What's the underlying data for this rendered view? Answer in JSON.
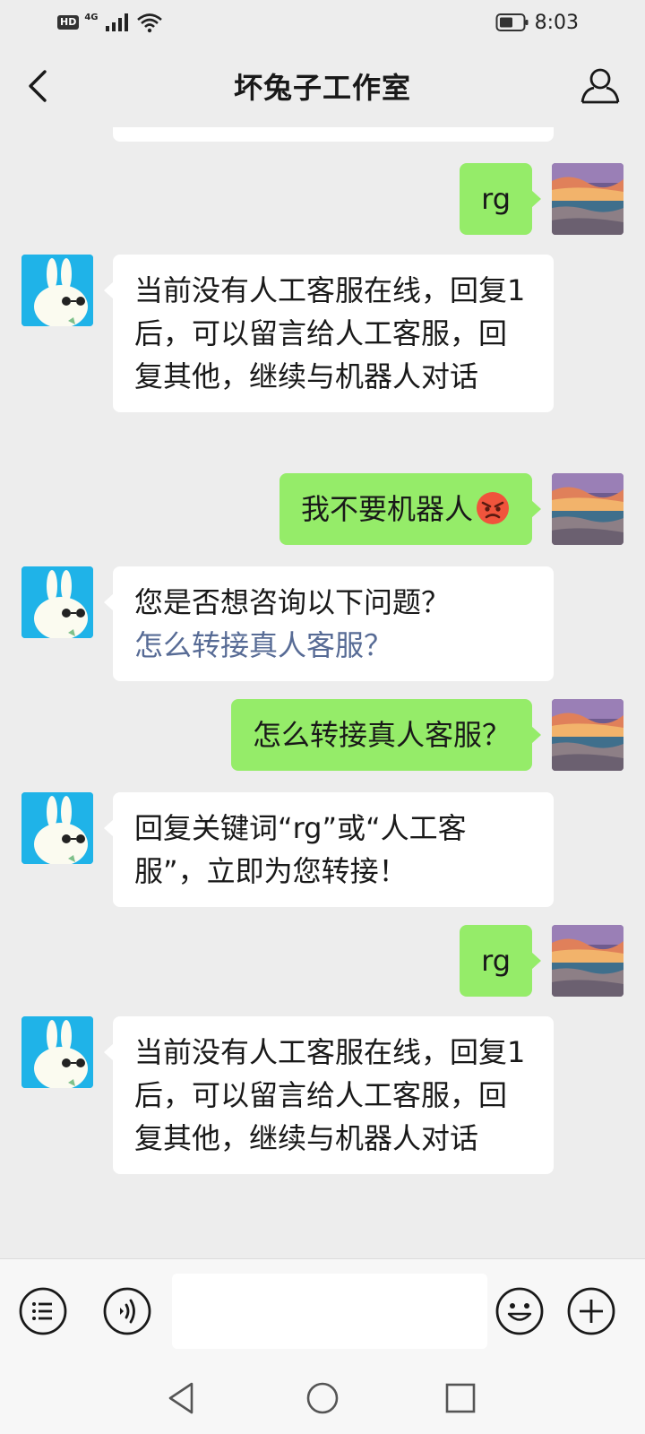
{
  "status_bar": {
    "hd": "HD",
    "network": "4G",
    "time": "8:03",
    "icons": [
      "signal-icon",
      "wifi-icon",
      "battery-icon"
    ]
  },
  "nav": {
    "title": "坏兔子工作室",
    "back_icon": "chevron-left-icon",
    "profile_icon": "person-icon"
  },
  "messages": [
    {
      "side": "out",
      "text": "rg"
    },
    {
      "side": "in",
      "text": "当前没有人工客服在线，回复1后，可以留言给人工客服，回复其他，继续与机器人对话"
    },
    {
      "side": "out",
      "text": "我不要机器人",
      "emoji": "angry-face-emoji"
    },
    {
      "side": "in",
      "text": "您是否想咨询以下问题？",
      "link": "怎么转接真人客服？"
    },
    {
      "side": "out",
      "text": "怎么转接真人客服？"
    },
    {
      "side": "in",
      "text": "回复关键词“rg”或“人工客服”，立即为您转接！"
    },
    {
      "side": "out",
      "text": "rg"
    },
    {
      "side": "in",
      "text": "当前没有人工客服在线，回复1后，可以留言给人工客服，回复其他，继续与机器人对话"
    }
  ],
  "input_bar": {
    "menu_icon": "menu-list-icon",
    "voice_icon": "voice-icon",
    "input_value": "",
    "emoji_icon": "smiley-icon",
    "add_icon": "plus-icon"
  },
  "system_nav": [
    "back-triangle-icon",
    "home-circle-icon",
    "recents-square-icon"
  ],
  "colors": {
    "background": "#ededed",
    "incoming_bubble": "#ffffff",
    "outgoing_bubble": "#95ec69",
    "link": "#576b95",
    "bot_avatar_bg": "#1fb3e8"
  }
}
